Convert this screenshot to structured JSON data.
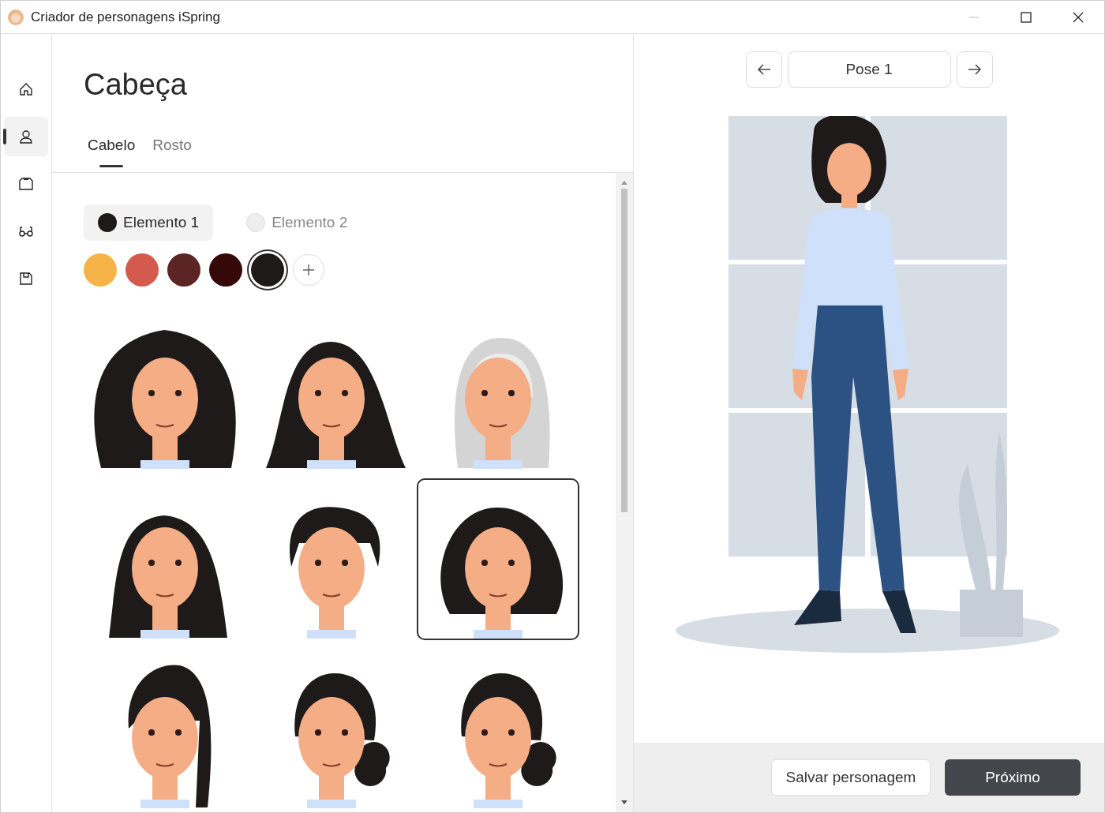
{
  "window": {
    "title": "Criador de personagens iSpring"
  },
  "sidebar": {
    "items": [
      {
        "kind": "home",
        "selected": false
      },
      {
        "kind": "person",
        "selected": true
      },
      {
        "kind": "shirt",
        "selected": false
      },
      {
        "kind": "glasses",
        "selected": false
      },
      {
        "kind": "save",
        "selected": false
      }
    ]
  },
  "section": {
    "title": "Cabeça"
  },
  "tabs": [
    {
      "label": "Cabelo",
      "selected": true
    },
    {
      "label": "Rosto",
      "selected": false
    }
  ],
  "elements": [
    {
      "label": "Elemento 1",
      "selected": true,
      "color": "#1e1a1a"
    },
    {
      "label": "Elemento 2",
      "selected": false,
      "color": "#eeeeee"
    }
  ],
  "swatches": [
    {
      "color": "#f6b347",
      "selected": false
    },
    {
      "color": "#d35a4d",
      "selected": false
    },
    {
      "color": "#5a2523",
      "selected": false
    },
    {
      "color": "#360808",
      "selected": false
    },
    {
      "color": "#1e1a1a",
      "selected": true
    }
  ],
  "hair_styles": [
    {
      "kind": "curly",
      "selected": false
    },
    {
      "kind": "long",
      "selected": false
    },
    {
      "kind": "hijab",
      "selected": false
    },
    {
      "kind": "straight",
      "selected": false
    },
    {
      "kind": "short",
      "selected": false
    },
    {
      "kind": "bob",
      "selected": true
    },
    {
      "kind": "braids",
      "selected": false
    },
    {
      "kind": "bun",
      "selected": false
    },
    {
      "kind": "bun",
      "selected": false
    }
  ],
  "pose": {
    "label": "Pose 1"
  },
  "buttons": [
    {
      "label": "Salvar personagem",
      "kind": "secondary"
    },
    {
      "label": "Próximo",
      "kind": "primary"
    }
  ]
}
